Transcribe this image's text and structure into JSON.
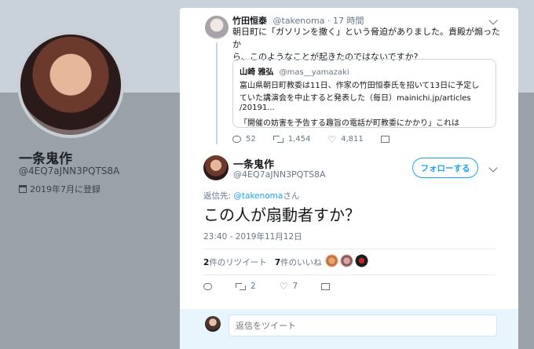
{
  "profile": {
    "name": "一条鬼作",
    "handle": "@4EQ7aJNN3PQTS8A",
    "joined": "2019年7月に登録"
  },
  "quoted_tweet": {
    "author": "竹田恒泰",
    "handle": "@takenoma",
    "time": "· 17 時間",
    "text_line1": "朝日町に「ガソリンを撒く」という脅迫がありました。貴殿が煽ったか",
    "text_line2": "ら、このようなことが起きたのではないですか?",
    "embedded": {
      "author": "山崎 雅弘",
      "handle": "@mas__yamazaki",
      "line1": "富山県朝日町教委は11日、作家の竹田恒泰氏を招いて13日に予定し",
      "line2": "ていた講演会を中止すると発表した（毎日）mainichi.jp/articles",
      "line3": "/20191...",
      "line4": "「開催の妨害を予告する趣旨の電話が町教委にかかり」これは"
    },
    "replies": "52",
    "retweets": "1,454",
    "likes": "4,811"
  },
  "main_tweet": {
    "author": "一条鬼作",
    "handle": "@4EQ7aJNN3PQTS8A",
    "follow_label": "フォローする",
    "reply_prefix": "返信先:",
    "reply_to": "@takenoma",
    "reply_suffix": "さん",
    "text": "この人が扇動者すか？",
    "timestamp": "23:40 - 2019年11月12日",
    "retweet_count": "2",
    "retweet_label": "件のリツイート",
    "like_count": "7",
    "like_label": "件のいいね",
    "action_retweets": "2",
    "action_likes": "7"
  },
  "reply_box": {
    "placeholder": "返信をツイート"
  },
  "colors": {
    "accent": "#1da1f2",
    "muted": "#657786"
  }
}
